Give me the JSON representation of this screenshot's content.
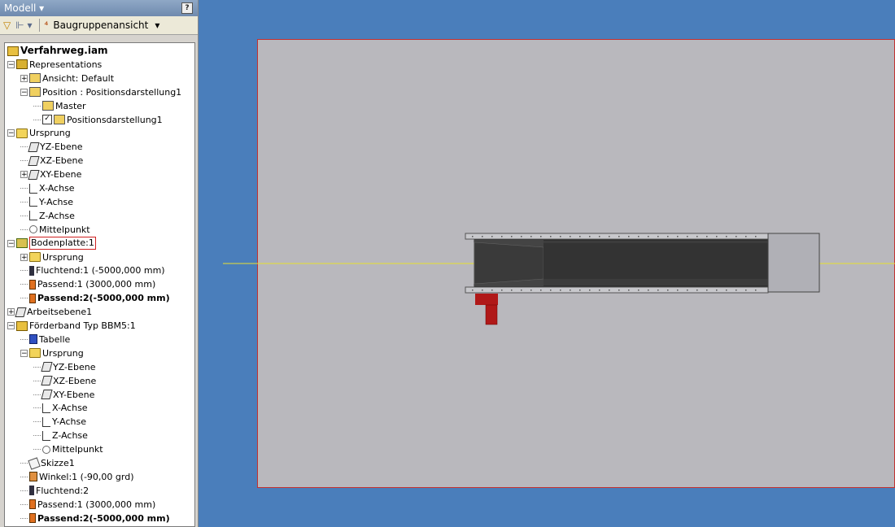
{
  "panel": {
    "title": "Modell ▾",
    "help": "?",
    "toolbar_view": "Baugruppenansicht"
  },
  "tree": [
    {
      "label": "Verfahrweg.iam",
      "icon": "assembly-icon",
      "bold": true,
      "indent": 0
    },
    {
      "label": "Representations",
      "icon": "representations-icon",
      "indent": 0,
      "exp": "-"
    },
    {
      "label": "Ansicht: Default",
      "icon": "view-rep-icon",
      "indent": 1,
      "exp": "+"
    },
    {
      "label": "Position : Positionsdarstellung1",
      "icon": "position-rep-icon",
      "indent": 1,
      "exp": "-"
    },
    {
      "label": "Master",
      "icon": "position-rep-icon",
      "indent": 2
    },
    {
      "label": "Positionsdarstellung1",
      "icon": "position-rep-icon",
      "indent": 2,
      "checked": true
    },
    {
      "label": "Ursprung",
      "icon": "folder-icon",
      "indent": 0,
      "exp": "-"
    },
    {
      "label": "YZ-Ebene",
      "icon": "plane-icon",
      "indent": 1
    },
    {
      "label": "XZ-Ebene",
      "icon": "plane-icon",
      "indent": 1
    },
    {
      "label": "XY-Ebene",
      "icon": "plane-icon",
      "indent": 1,
      "exp": "+"
    },
    {
      "label": "X-Achse",
      "icon": "axis-icon",
      "indent": 1
    },
    {
      "label": "Y-Achse",
      "icon": "axis-icon",
      "indent": 1
    },
    {
      "label": "Z-Achse",
      "icon": "axis-icon",
      "indent": 1
    },
    {
      "label": "Mittelpunkt",
      "icon": "point-icon",
      "indent": 1
    },
    {
      "label": "Bodenplatte:1",
      "icon": "part-icon",
      "indent": 0,
      "exp": "-",
      "highlight": true
    },
    {
      "label": "Ursprung",
      "icon": "folder-icon",
      "indent": 1,
      "exp": "+"
    },
    {
      "label": "Fluchtend:1 (-5000,000 mm)",
      "icon": "flush-constraint-icon",
      "indent": 1
    },
    {
      "label": "Passend:1 (3000,000 mm)",
      "icon": "mate-constraint-icon",
      "indent": 1
    },
    {
      "label": "Passend:2(-5000,000 mm)",
      "icon": "mate-constraint-icon",
      "indent": 1,
      "bold": true
    },
    {
      "label": "Arbeitsebene1",
      "icon": "plane-icon",
      "indent": 0,
      "exp": "+"
    },
    {
      "label": "Förderband Typ BBM5:1",
      "icon": "subassembly-icon",
      "indent": 0,
      "exp": "-"
    },
    {
      "label": "Tabelle",
      "icon": "table-icon",
      "indent": 1
    },
    {
      "label": "Ursprung",
      "icon": "folder-icon",
      "indent": 1,
      "exp": "-"
    },
    {
      "label": "YZ-Ebene",
      "icon": "plane-icon",
      "indent": 2
    },
    {
      "label": "XZ-Ebene",
      "icon": "plane-icon",
      "indent": 2
    },
    {
      "label": "XY-Ebene",
      "icon": "plane-icon",
      "indent": 2
    },
    {
      "label": "X-Achse",
      "icon": "axis-icon",
      "indent": 2
    },
    {
      "label": "Y-Achse",
      "icon": "axis-icon",
      "indent": 2
    },
    {
      "label": "Z-Achse",
      "icon": "axis-icon",
      "indent": 2
    },
    {
      "label": "Mittelpunkt",
      "icon": "point-icon",
      "indent": 2
    },
    {
      "label": "Skizze1",
      "icon": "sketch-icon",
      "indent": 1
    },
    {
      "label": "Winkel:1 (-90,00 grd)",
      "icon": "angle-constraint-icon",
      "indent": 1
    },
    {
      "label": "Fluchtend:2",
      "icon": "flush-constraint-icon",
      "indent": 1
    },
    {
      "label": "Passend:1 (3000,000 mm)",
      "icon": "mate-constraint-icon",
      "indent": 1
    },
    {
      "label": "Passend:2(-5000,000 mm)",
      "icon": "mate-constraint-icon",
      "indent": 1,
      "bold": true
    }
  ],
  "colors": {
    "viewport_bg": "#4a7ebb",
    "sheet": "#b9b8bd",
    "sheet_border": "#c23030",
    "axis_line": "#e8e030",
    "conveyor_dark": "#3c3c3c",
    "conveyor_frame": "#c8c8cc",
    "motor_red": "#b01818"
  }
}
